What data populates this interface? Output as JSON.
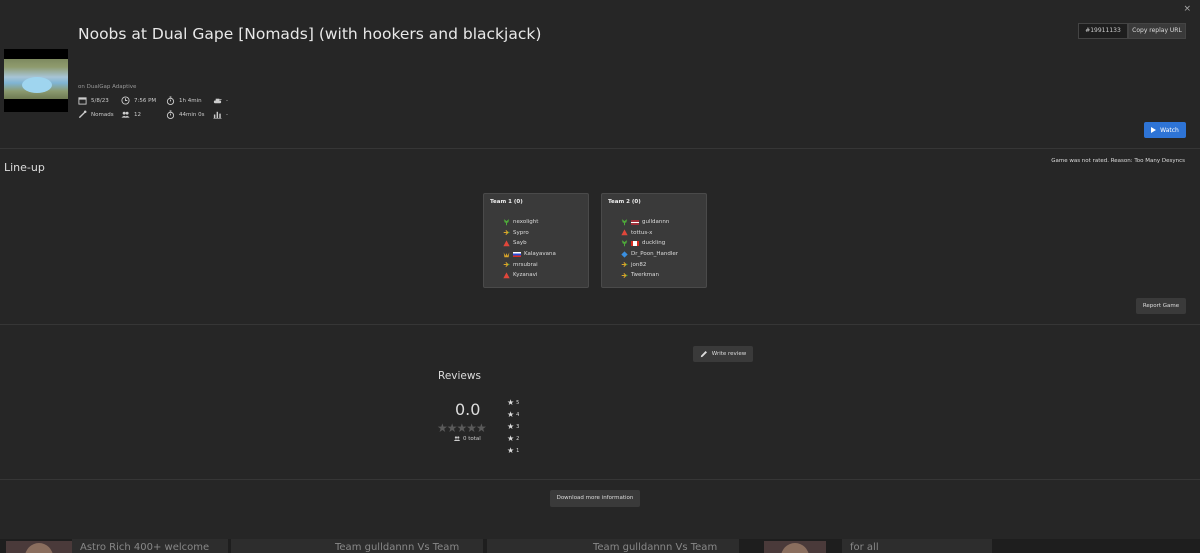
{
  "header": {
    "title": "Noobs at Dual Gape [Nomads] (with hookers and blackjack)",
    "replay_id": "#19911133",
    "copy_url_label": "Copy replay URL",
    "close_label": "×"
  },
  "game": {
    "map_name": "on DualGap Adaptive",
    "date": "5/8/23",
    "time": "7:56 PM",
    "duration": "1h 4min",
    "unit_cap": "-",
    "featured_mod": "Nomads",
    "players": "12",
    "game_time": "44min 0s",
    "rating_change": "-",
    "watch_label": "Watch"
  },
  "lineup": {
    "heading": "Line-up",
    "not_rated": "Game was not rated. Reason: Too Many Desyncs",
    "teams": [
      {
        "name": "Team 1 (0)",
        "players": [
          {
            "faction": "seraphim",
            "flag": "",
            "name": "nexolight"
          },
          {
            "faction": "nomads",
            "flag": "",
            "name": "Sypro"
          },
          {
            "faction": "cybran",
            "flag": "",
            "name": "Sayb"
          },
          {
            "faction": "aeon",
            "flag": "ru",
            "name": "Kalayavana"
          },
          {
            "faction": "nomads",
            "flag": "",
            "name": "mrsubrai"
          },
          {
            "faction": "cybran",
            "flag": "",
            "name": "Kyzanavi"
          }
        ]
      },
      {
        "name": "Team 2 (0)",
        "players": [
          {
            "faction": "seraphim",
            "flag": "lv",
            "name": "gulldannn"
          },
          {
            "faction": "cybran",
            "flag": "",
            "name": "tottus-x"
          },
          {
            "faction": "seraphim",
            "flag": "ca",
            "name": "duckling"
          },
          {
            "faction": "uef",
            "flag": "",
            "name": "Dr_Poon_Handler"
          },
          {
            "faction": "nomads",
            "flag": "",
            "name": "jon82"
          },
          {
            "faction": "nomads",
            "flag": "",
            "name": "Twerkman"
          }
        ]
      }
    ],
    "report_label": "Report Game"
  },
  "reviews": {
    "heading": "Reviews",
    "write_label": "Write review",
    "score": "0.0",
    "total": "0 total",
    "rating_fraction": 0,
    "distribution": [
      "5",
      "4",
      "3",
      "2",
      "1"
    ]
  },
  "download_label": "Download more information",
  "bottom_cards": [
    {
      "text": "Astro Rich 400+ welcome"
    },
    {
      "text": "Team gulldannn Vs Team"
    },
    {
      "text": "Team gulldannn Vs Team"
    },
    {
      "text": "for all"
    }
  ],
  "colors": {
    "background": "#262626",
    "accent": "#2e74d6",
    "seraphim": "#4fae3a",
    "cybran": "#e0463a",
    "aeon": "#d9a52a",
    "uef": "#3a8fe0",
    "nomads": "#d9a52a"
  }
}
